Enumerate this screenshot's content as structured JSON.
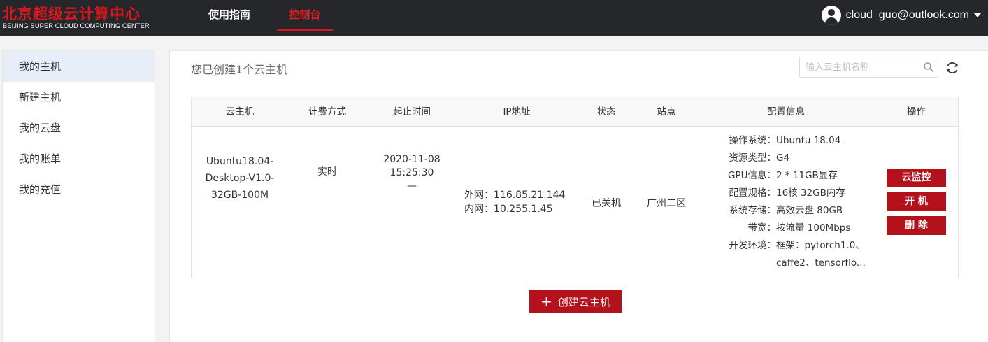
{
  "header": {
    "logo_cn": "北京超级云计算中心",
    "logo_en": "BEIJING SUPER CLOUD COMPUTING CENTER",
    "nav": [
      {
        "label": "使用指南",
        "active": false
      },
      {
        "label": "控制台",
        "active": true
      }
    ],
    "user_email": "cloud_guo@outlook.com",
    "icons": {
      "avatar": "user-icon",
      "dropdown": "caret-down-icon"
    }
  },
  "sidebar": {
    "items": [
      {
        "label": "我的主机",
        "active": true
      },
      {
        "label": "新建主机",
        "active": false
      },
      {
        "label": "我的云盘",
        "active": false
      },
      {
        "label": "我的账单",
        "active": false
      },
      {
        "label": "我的充值",
        "active": false
      }
    ]
  },
  "main": {
    "title": "您已创建1个云主机",
    "search_placeholder": "输入云主机名称",
    "icons": {
      "search": "search-icon",
      "refresh": "refresh-icon"
    },
    "table": {
      "columns": [
        "云主机",
        "计费方式",
        "起止时间",
        "IP地址",
        "状态",
        "站点",
        "配置信息",
        "操作"
      ],
      "rows": [
        {
          "host_lines": [
            "Ubuntu18.04-",
            "Desktop-V1.0-",
            "32GB-100M"
          ],
          "billing": "实时",
          "time_lines": [
            "2020-11-08",
            "15:25:30",
            "—"
          ],
          "ip_lines": [
            "外网：116.85.21.144",
            "内网：10.255.1.45"
          ],
          "status": "已关机",
          "site": "广州二区",
          "config": [
            {
              "label": "操作系统：",
              "value": "Ubuntu 18.04"
            },
            {
              "label": "资源类型：",
              "value": "G4"
            },
            {
              "label": "GPU信息：",
              "value": "2 * 11GB显存"
            },
            {
              "label": "配置规格：",
              "value": "16核 32GB内存"
            },
            {
              "label": "系统存储：",
              "value": "高效云盘 80GB"
            },
            {
              "label": "带宽：",
              "value": "按流量 100Mbps"
            },
            {
              "label": "开发环境：",
              "value": "框架：pytorch1.0、",
              "value2": "caffe2、tensorflo..."
            }
          ],
          "actions": [
            "云监控",
            "开 机",
            "删 除"
          ]
        }
      ]
    },
    "create_button": "创建云主机",
    "colors": {
      "accent": "#b3111c",
      "brand_red": "#d9161e",
      "topbar": "#26272b"
    }
  }
}
